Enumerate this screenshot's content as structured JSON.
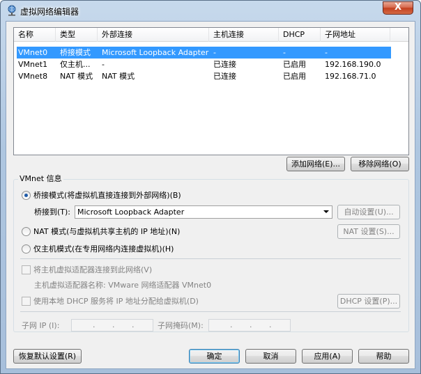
{
  "window": {
    "title": "虚拟网络编辑器",
    "close_label": "X"
  },
  "table": {
    "headers": [
      "名称",
      "类型",
      "外部连接",
      "主机连接",
      "DHCP",
      "子网地址"
    ],
    "rows": [
      {
        "name": "VMnet0",
        "type": "桥接模式",
        "external": "Microsoft Loopback Adapter",
        "host": "-",
        "dhcp": "-",
        "subnet": "-"
      },
      {
        "name": "VMnet1",
        "type": "仅主机...",
        "external": "-",
        "host": "已连接",
        "dhcp": "已启用",
        "subnet": "192.168.190.0"
      },
      {
        "name": "VMnet8",
        "type": "NAT 模式",
        "external": "NAT 模式",
        "host": "已连接",
        "dhcp": "已启用",
        "subnet": "192.168.71.0"
      }
    ]
  },
  "buttons": {
    "add_network": "添加网络(E)...",
    "remove_network": "移除网络(O)",
    "auto_settings": "自动设置(U)...",
    "nat_settings": "NAT 设置(S)...",
    "dhcp_settings": "DHCP 设置(P)...",
    "restore_defaults": "恢复默认设置(R)",
    "ok": "确定",
    "cancel": "取消",
    "apply": "应用(A)",
    "help": "帮助"
  },
  "vmnet_info": {
    "group_label": "VMnet 信息",
    "bridged_label": "桥接模式(将虚拟机直接连接到外部网络)(B)",
    "bridged_to_label": "桥接到(T):",
    "bridged_to_value": "Microsoft Loopback Adapter",
    "nat_label": "NAT 模式(与虚拟机共享主机的 IP 地址)(N)",
    "hostonly_label": "仅主机模式(在专用网络内连接虚拟机)(H)",
    "connect_adapter_label": "将主机虚拟适配器连接到此网络(V)",
    "adapter_name_label": "主机虚拟适配器名称: VMware 网络适配器 VMnet0",
    "use_dhcp_label": "使用本地 DHCP 服务将 IP 地址分配给虚拟机(D)",
    "subnet_ip_label": "子网 IP (I):",
    "subnet_mask_label": "子网掩码(M):",
    "ip_dot": "."
  }
}
